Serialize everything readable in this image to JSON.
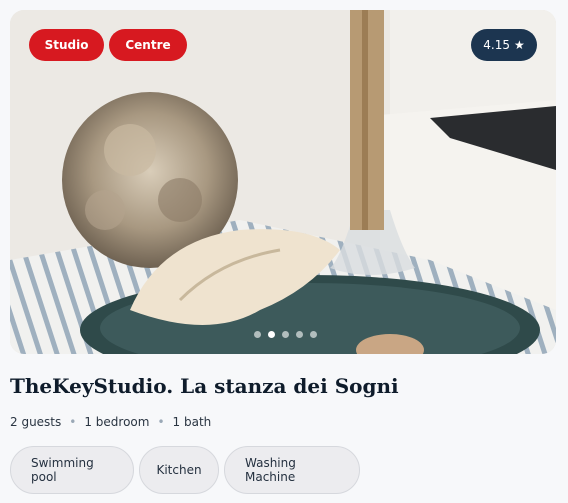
{
  "badges": [
    "Studio",
    "Centre"
  ],
  "rating": {
    "value": "4.15",
    "icon": "star-icon",
    "symbol": "★"
  },
  "gallery": {
    "total_images": 5,
    "active_index": 1
  },
  "listing": {
    "title": "TheKeyStudio. La stanza dei Sogni"
  },
  "specs": {
    "guests": "2 guests",
    "bedrooms": "1 bedroom",
    "baths": "1 bath",
    "separator": "•"
  },
  "amenities": [
    "Swimming pool",
    "Kitchen",
    "Washing Machine"
  ],
  "colors": {
    "badge": "#d71920",
    "rating_bg": "#1c3550",
    "chip_bg": "#ececef"
  }
}
